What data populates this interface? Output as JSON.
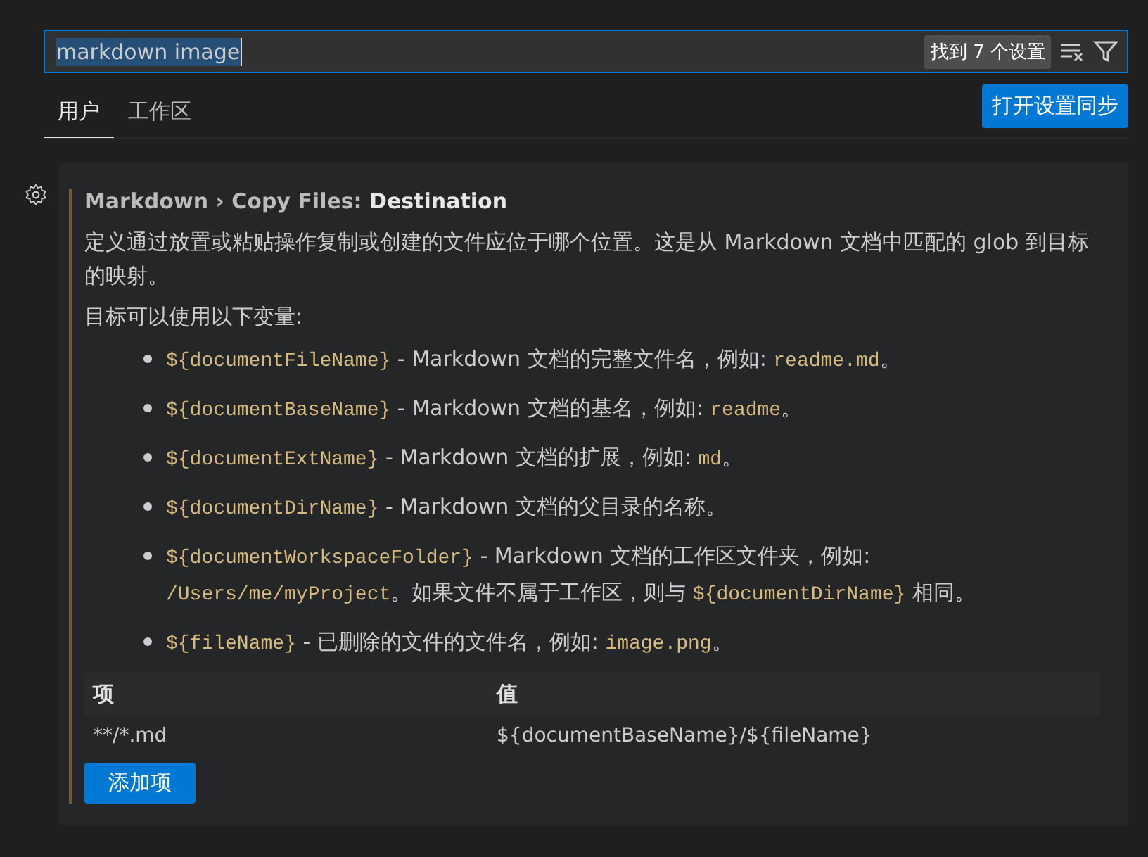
{
  "search": {
    "value": "markdown image",
    "result_count": "找到 7 个设置"
  },
  "tabs": [
    {
      "label": "用户",
      "selected": true
    },
    {
      "label": "工作区",
      "selected": false
    }
  ],
  "sync_button": "打开设置同步",
  "setting": {
    "category": "Markdown › Copy Files: ",
    "name": "Destination",
    "description": "定义通过放置或粘贴操作复制或创建的文件应位于哪个位置。这是从 Markdown 文档中匹配的 glob 到目标的映射。",
    "variables_intro": "目标可以使用以下变量:",
    "variables": [
      [
        {
          "kind": "code",
          "text": "${documentFileName}"
        },
        {
          "kind": "text",
          "text": " - Markdown 文档的完整文件名，例如: "
        },
        {
          "kind": "code",
          "text": "readme.md"
        },
        {
          "kind": "text",
          "text": "。"
        }
      ],
      [
        {
          "kind": "code",
          "text": "${documentBaseName}"
        },
        {
          "kind": "text",
          "text": " - Markdown 文档的基名，例如: "
        },
        {
          "kind": "code",
          "text": "readme"
        },
        {
          "kind": "text",
          "text": "。"
        }
      ],
      [
        {
          "kind": "code",
          "text": "${documentExtName}"
        },
        {
          "kind": "text",
          "text": " - Markdown 文档的扩展，例如: "
        },
        {
          "kind": "code",
          "text": "md"
        },
        {
          "kind": "text",
          "text": "。"
        }
      ],
      [
        {
          "kind": "code",
          "text": "${documentDirName}"
        },
        {
          "kind": "text",
          "text": " - Markdown 文档的父目录的名称。"
        }
      ],
      [
        {
          "kind": "code",
          "text": "${documentWorkspaceFolder}"
        },
        {
          "kind": "text",
          "text": " - Markdown 文档的工作区文件夹，例如: "
        },
        {
          "kind": "code",
          "text": "/Users/me/myProject"
        },
        {
          "kind": "text",
          "text": "。如果文件不属于工作区，则与 "
        },
        {
          "kind": "code",
          "text": "${documentDirName}"
        },
        {
          "kind": "text",
          "text": " 相同。"
        }
      ],
      [
        {
          "kind": "code",
          "text": "${fileName}"
        },
        {
          "kind": "text",
          "text": " - 已删除的文件的文件名，例如: "
        },
        {
          "kind": "code",
          "text": "image.png"
        },
        {
          "kind": "text",
          "text": "。"
        }
      ]
    ],
    "table": {
      "columns": [
        "项",
        "值"
      ],
      "rows": [
        [
          "**/*.md",
          "${documentBaseName}/${fileName}"
        ]
      ]
    },
    "add_button": "添加项"
  }
}
